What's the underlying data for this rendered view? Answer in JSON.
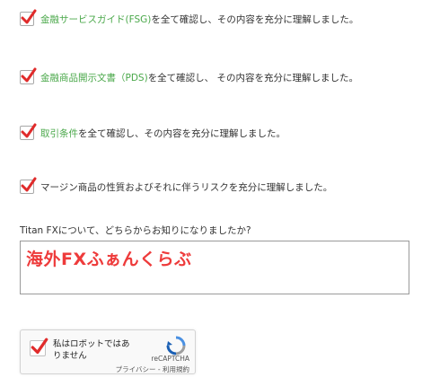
{
  "agreements": [
    {
      "link": "金融サービスガイド(FSG)",
      "text": "を全て確認し、その内容を充分に理解しました。",
      "checked": true
    },
    {
      "link": "金融商品開示文書（PDS)",
      "text": "を全て確認し、 その内容を充分に理解しました。",
      "checked": true
    },
    {
      "link": "取引条件",
      "text": "を全て確認し、その内容を充分に理解しました。",
      "checked": true
    },
    {
      "link": "",
      "text": "マージン商品の性質およびそれに伴うリスクを充分に理解しました。",
      "checked": true
    }
  ],
  "referral": {
    "question": "Titan FXについて、どちらからお知りになりましたか?",
    "answer": "海外FXふぁんくらぶ"
  },
  "captcha": {
    "label": "私はロボットではありません",
    "brand": "reCAPTCHA",
    "privacy": "プライバシー",
    "separator": " - ",
    "terms": "利用規約"
  },
  "colors": {
    "link": "#4aa84a",
    "check": "#e02b2b",
    "answer": "#ee3b3b"
  }
}
